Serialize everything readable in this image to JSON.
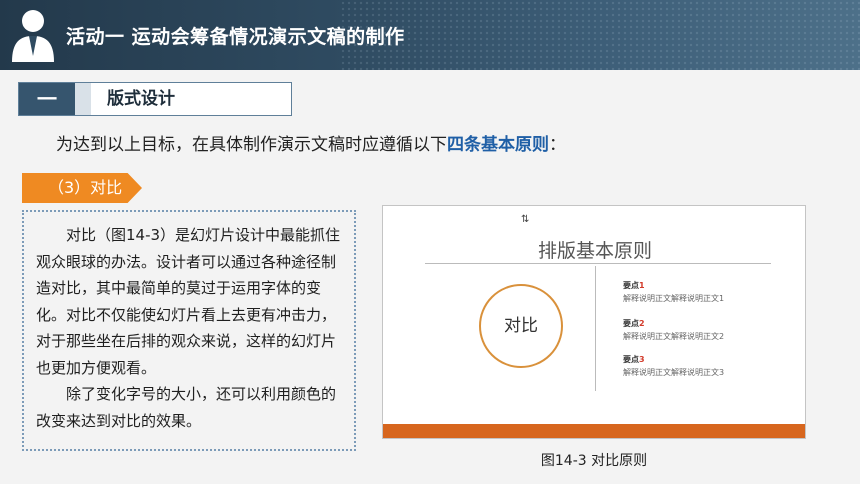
{
  "header": {
    "title": "活动一  运动会筹备情况演示文稿的制作",
    "icon": "user-icon"
  },
  "section": {
    "number": "一",
    "label": "版式设计"
  },
  "intro": {
    "text": "为达到以上目标，在具体制作演示文稿时应遵循以下",
    "highlight": "四条基本原则",
    "end": "："
  },
  "point": {
    "label": "（3）对比"
  },
  "body": {
    "paragraphs": [
      "对比（图14-3）是幻灯片设计中最能抓住观众眼球的办法。设计者可以通过各种途径制造对比，其中最简单的莫过于运用字体的变化。对比不仅能使幻灯片看上去更有冲击力，对于那些坐在后排的观众来说，这样的幻灯片也更加方便观看。",
      "除了变化字号的大小，还可以利用颜色的改变来达到对比的效果。"
    ]
  },
  "figure": {
    "title": "排版基本原则",
    "circle_label": "对比",
    "items": [
      {
        "title": "要点",
        "num": "1",
        "desc": "解释说明正文解释说明正文1"
      },
      {
        "title": "要点",
        "num": "2",
        "desc": "解释说明正文解释说明正文2"
      },
      {
        "title": "要点",
        "num": "3",
        "desc": "解释说明正文解释说明正文3"
      }
    ],
    "caption": "图14-3  对比原则",
    "colors": {
      "accent": "#d7661e",
      "circle": "#d9913b"
    }
  }
}
